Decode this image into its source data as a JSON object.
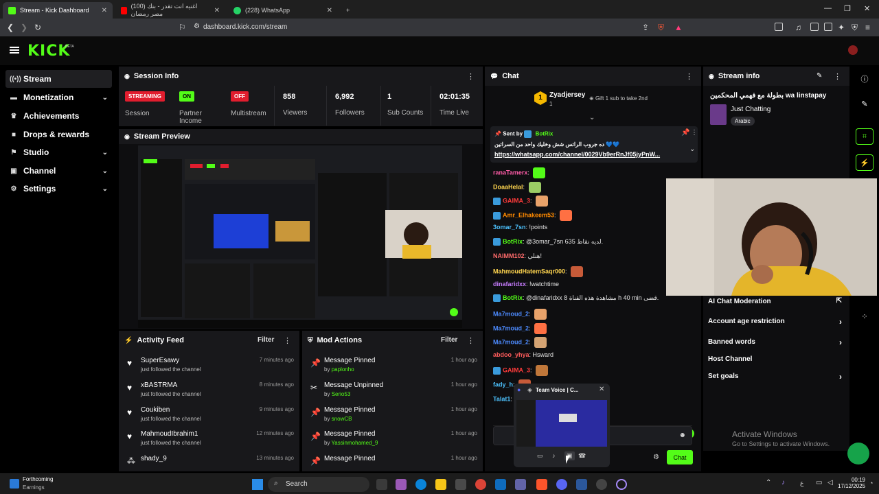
{
  "browser": {
    "tabs": [
      {
        "title": "Stream - Kick Dashboard",
        "color": "#53fc18"
      },
      {
        "title": "(100) اغنيه انت تقدر - بنك مصر رمضان",
        "color": "#ff0000"
      },
      {
        "title": "(228) WhatsApp",
        "color": "#25d366"
      }
    ],
    "url": "dashboard.kick.com/stream"
  },
  "header": {
    "logo": "KICK",
    "logo_sup": "BETA"
  },
  "sidebar": {
    "items": [
      {
        "label": "Stream",
        "icon": "stream-icon"
      },
      {
        "label": "Monetization",
        "icon": "money-icon"
      },
      {
        "label": "Achievements",
        "icon": "trophy-icon"
      },
      {
        "label": "Drops & rewards",
        "icon": "gift-icon"
      },
      {
        "label": "Studio",
        "icon": "studio-icon"
      },
      {
        "label": "Channel",
        "icon": "channel-icon"
      },
      {
        "label": "Settings",
        "icon": "gear-icon"
      }
    ]
  },
  "session": {
    "title": "Session Info",
    "streaming_badge": "STREAMING",
    "session_label": "Session",
    "partner_badge": "ON",
    "partner_label": "Partner Income",
    "multistream_badge": "OFF",
    "multistream_label": "Multistream",
    "viewers": "858",
    "viewers_label": "Viewers",
    "followers": "6,992",
    "followers_label": "Followers",
    "subs": "1",
    "subs_label": "Sub Counts",
    "time": "02:01:35",
    "time_label": "Time Live"
  },
  "preview": {
    "title": "Stream Preview"
  },
  "activity": {
    "title": "Activity Feed",
    "filter": "Filter",
    "items": [
      {
        "name": "SuperEsawy",
        "sub": "just followed the channel",
        "time": "7 minutes ago"
      },
      {
        "name": "xBASTRMA",
        "sub": "just followed the channel",
        "time": "8 minutes ago"
      },
      {
        "name": "Coukiben",
        "sub": "just followed the channel",
        "time": "9 minutes ago"
      },
      {
        "name": "MahmoudIbrahim1",
        "sub": "just followed the channel",
        "time": "12 minutes ago"
      },
      {
        "name": "shady_9",
        "sub": "",
        "time": "13 minutes ago"
      }
    ]
  },
  "mod": {
    "title": "Mod Actions",
    "filter": "Filter",
    "items": [
      {
        "action": "Message Pinned",
        "by": "by",
        "user": "paplonho",
        "time": "1 hour ago"
      },
      {
        "action": "Message Unpinned",
        "by": "by",
        "user": "Serio53",
        "time": "1 hour ago"
      },
      {
        "action": "Message Pinned",
        "by": "by",
        "user": "snowCB",
        "time": "1 hour ago"
      },
      {
        "action": "Message Pinned",
        "by": "by",
        "user": "Yassinmohamed_9",
        "time": "1 hour ago"
      },
      {
        "action": "Message Pinned",
        "by": "by",
        "user": "",
        "time": "1 hour ago"
      }
    ]
  },
  "chat": {
    "title": "Chat",
    "top_gifter": "Zyadjersey",
    "top_gifter_count": "1",
    "gift_text": "Gift 1 sub to take 2nd",
    "pinned_sent_by": "Sent by",
    "pinned_user": "BotRix",
    "pinned_text": "ده جروب الراتس شش وخليك واحد من السراتين 💙💙",
    "pinned_link": "https://whatsapp.com/channel/0029Vb9erRnJf05jyPnW...",
    "messages": [
      {
        "user": "ranaTamerx",
        "color": "#ff5ca8",
        "text": ""
      },
      {
        "user": "DoaaHelal",
        "color": "#ffd54f",
        "text": ""
      },
      {
        "user": "GAIMA_3",
        "color": "#ff3b3b",
        "text": ""
      },
      {
        "user": "Amr_Elhakeem53",
        "color": "#ff8a00",
        "text": ""
      },
      {
        "user": "3omar_7sn",
        "color": "#4dc3ff",
        "text": "!points"
      },
      {
        "user": "BotRix",
        "color": "#53fc18",
        "text": "@3omar_7sn 635 لديه نقاط."
      },
      {
        "user": "NAIMM102",
        "color": "#ff6b6b",
        "text": "هنلي!"
      },
      {
        "user": "MahmoudHatemSaqr000",
        "color": "#ffd54f",
        "text": ""
      },
      {
        "user": "dinafaridxx",
        "color": "#c77dff",
        "text": "!watchtime"
      },
      {
        "user": "BotRix",
        "color": "#53fc18",
        "text": "@dinafaridxx 8 مشاهدة هذه القناة h 40 min قضى."
      },
      {
        "user": "Ma7moud_2",
        "color": "#4d8bff",
        "text": ""
      },
      {
        "user": "Ma7moud_2",
        "color": "#4d8bff",
        "text": ""
      },
      {
        "user": "Ma7moud_2",
        "color": "#4d8bff",
        "text": ""
      },
      {
        "user": "abdoo_yhya",
        "color": "#ff5c5c",
        "text": "Hsward"
      },
      {
        "user": "GAIMA_3",
        "color": "#ff3b3b",
        "text": ""
      },
      {
        "user": "fady_h",
        "color": "#4dc3ff",
        "text": ""
      },
      {
        "user": "Talat1",
        "color": "#4dc3ff",
        "text": ""
      }
    ],
    "send_label": "Chat"
  },
  "streaminfo": {
    "title": "Stream info",
    "stream_title": "بطولة مع فهمي المحكمين wa linstapay",
    "category": "Just Chatting",
    "tag": "Arabic",
    "menu": [
      {
        "label": "AI Chat Moderation",
        "chev": "external"
      },
      {
        "label": "Account age restriction",
        "chev": "right"
      },
      {
        "label": "Banned words",
        "chev": "right"
      },
      {
        "label": "Host Channel",
        "chev": ""
      },
      {
        "label": "Set goals",
        "chev": "right"
      }
    ]
  },
  "discord": {
    "title": "Team Voice | C..."
  },
  "watermark": {
    "line1": "Activate Windows",
    "line2": "Go to Settings to activate Windows."
  },
  "taskbar": {
    "weather_title": "Forthcoming",
    "weather_sub": "Earnings",
    "search": "Search",
    "time": "00:19",
    "date": "17/12/2025",
    "lang": "ع"
  },
  "colors": {
    "kick_green": "#53fc18",
    "panel": "#18181b",
    "red": "#e11d2e"
  }
}
